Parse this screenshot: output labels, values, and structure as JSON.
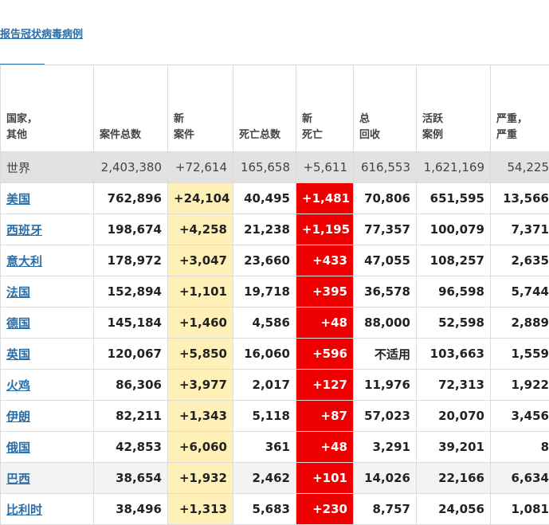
{
  "top_link": "报告冠状病毒病例",
  "headers": {
    "country_l1": "国家，",
    "country_l2": "其他",
    "total_cases": "案件总数",
    "new_cases_l1": "新",
    "new_cases_l2": "案件",
    "total_deaths": "死亡总数",
    "new_deaths_l1": "新",
    "new_deaths_l2": "死亡",
    "recovered_l1": "总",
    "recovered_l2": "回收",
    "active_l1": "活跃",
    "active_l2": "案例",
    "serious_l1": "严重，",
    "serious_l2": "严重"
  },
  "colors": {
    "link": "#2a6ea8",
    "new_cases_bg": "#fff0b8",
    "new_deaths_bg": "#ee0000",
    "world_row_bg": "#e2e2e2"
  },
  "rows": [
    {
      "country": "世界",
      "total_cases": "2,403,380",
      "new_cases": "+72,614",
      "total_deaths": "165,658",
      "new_deaths": "+5,611",
      "recovered": "616,553",
      "active": "1,621,169",
      "serious": "54,225"
    },
    {
      "country": "美国",
      "total_cases": "762,896",
      "new_cases": "+24,104",
      "total_deaths": "40,495",
      "new_deaths": "+1,481",
      "recovered": "70,806",
      "active": "651,595",
      "serious": "13,566"
    },
    {
      "country": "西班牙",
      "total_cases": "198,674",
      "new_cases": "+4,258",
      "total_deaths": "21,238",
      "new_deaths": "+1,195",
      "recovered": "77,357",
      "active": "100,079",
      "serious": "7,371"
    },
    {
      "country": "意大利",
      "total_cases": "178,972",
      "new_cases": "+3,047",
      "total_deaths": "23,660",
      "new_deaths": "+433",
      "recovered": "47,055",
      "active": "108,257",
      "serious": "2,635"
    },
    {
      "country": "法国",
      "total_cases": "152,894",
      "new_cases": "+1,101",
      "total_deaths": "19,718",
      "new_deaths": "+395",
      "recovered": "36,578",
      "active": "96,598",
      "serious": "5,744"
    },
    {
      "country": "德国",
      "total_cases": "145,184",
      "new_cases": "+1,460",
      "total_deaths": "4,586",
      "new_deaths": "+48",
      "recovered": "88,000",
      "active": "52,598",
      "serious": "2,889"
    },
    {
      "country": "英国",
      "total_cases": "120,067",
      "new_cases": "+5,850",
      "total_deaths": "16,060",
      "new_deaths": "+596",
      "recovered": "不适用",
      "active": "103,663",
      "serious": "1,559"
    },
    {
      "country": "火鸡",
      "total_cases": "86,306",
      "new_cases": "+3,977",
      "total_deaths": "2,017",
      "new_deaths": "+127",
      "recovered": "11,976",
      "active": "72,313",
      "serious": "1,922"
    },
    {
      "country": "伊朗",
      "total_cases": "82,211",
      "new_cases": "+1,343",
      "total_deaths": "5,118",
      "new_deaths": "+87",
      "recovered": "57,023",
      "active": "20,070",
      "serious": "3,456"
    },
    {
      "country": "俄国",
      "total_cases": "42,853",
      "new_cases": "+6,060",
      "total_deaths": "361",
      "new_deaths": "+48",
      "recovered": "3,291",
      "active": "39,201",
      "serious": "8"
    },
    {
      "country": "巴西",
      "total_cases": "38,654",
      "new_cases": "+1,932",
      "total_deaths": "2,462",
      "new_deaths": "+101",
      "recovered": "14,026",
      "active": "22,166",
      "serious": "6,634"
    },
    {
      "country": "比利时",
      "total_cases": "38,496",
      "new_cases": "+1,313",
      "total_deaths": "5,683",
      "new_deaths": "+230",
      "recovered": "8,757",
      "active": "24,056",
      "serious": "1,081"
    }
  ]
}
